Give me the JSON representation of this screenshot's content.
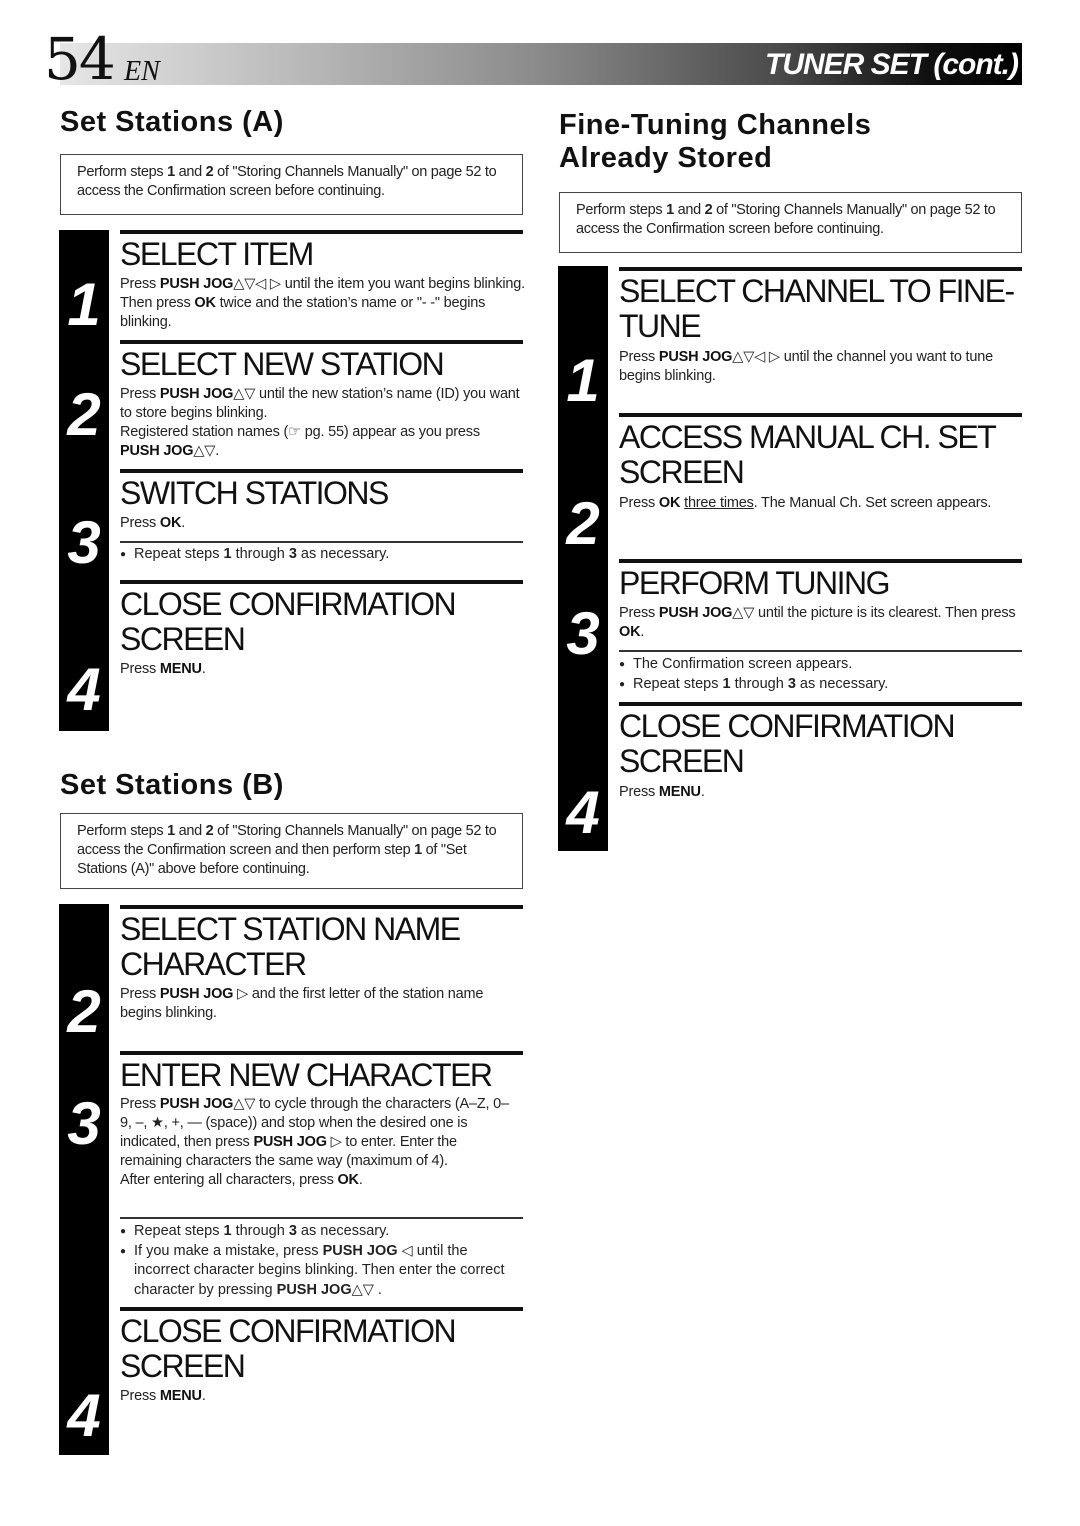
{
  "header": {
    "page_number": "54",
    "language": "EN",
    "section_title": "TUNER SET (cont.)"
  },
  "set_stations_a": {
    "title": "Set Stations (A)",
    "note": [
      "Perform steps ",
      "1",
      " and ",
      "2",
      " of \"Storing Channels Manually\" on page 52 to access the Confirmation screen before continuing."
    ],
    "steps": [
      {
        "number": "1",
        "title": "SELECT ITEM",
        "body": [
          "Press ",
          "PUSH JOG",
          "△▽◁ ▷ until the item you want begins blinking. Then press ",
          "OK",
          " twice and the station’s name or \"- -\" begins blinking."
        ]
      },
      {
        "number": "2",
        "title": "SELECT NEW STATION",
        "body": [
          "Press ",
          "PUSH JOG",
          "△▽ until the new station’s name (ID) you want to store begins blinking."
        ],
        "body2": [
          "Registered station names (",
          "☞",
          " pg. 55) appear as you press ",
          "PUSH JOG",
          "△▽."
        ]
      },
      {
        "number": "3",
        "title": "SWITCH STATIONS",
        "body": [
          "Press ",
          "OK",
          "."
        ],
        "bullets": [
          [
            "Repeat steps ",
            "1",
            " through ",
            "3",
            " as necessary."
          ]
        ]
      },
      {
        "number": "4",
        "title": "CLOSE CONFIRMATION SCREEN",
        "body": [
          "Press ",
          "MENU",
          "."
        ]
      }
    ]
  },
  "set_stations_b": {
    "title": "Set Stations (B)",
    "note": [
      "Perform steps ",
      "1",
      " and ",
      "2",
      " of \"Storing Channels Manually\" on page 52 to access the Confirmation screen and then perform step ",
      "1",
      " of \"Set Stations (A)\" above before continuing."
    ],
    "steps": [
      {
        "number": "2",
        "title": "SELECT STATION NAME CHARACTER",
        "body": [
          "Press ",
          "PUSH JOG",
          " ▷ and the first letter of the station name begins blinking."
        ]
      },
      {
        "number": "3",
        "title": "ENTER NEW CHARACTER",
        "body": [
          "Press ",
          "PUSH JOG",
          "△▽ to cycle through the characters (A–Z, 0–9, –, ★, +, — (space)) and stop when the desired one is indicated, then press ",
          "PUSH JOG",
          " ▷ to enter. Enter the remaining characters the same way (maximum of 4)."
        ],
        "body2": [
          "After entering all characters, press ",
          "OK",
          "."
        ],
        "bullets": [
          [
            "Repeat steps ",
            "1",
            " through ",
            "3",
            " as necessary."
          ],
          [
            "If you make a mistake, press ",
            "PUSH JOG",
            " ◁ until the incorrect character begins blinking. Then enter the correct character by pressing ",
            "PUSH JOG",
            "△▽ ."
          ]
        ]
      },
      {
        "number": "4",
        "title": "CLOSE CONFIRMATION SCREEN",
        "body": [
          "Press ",
          "MENU",
          "."
        ]
      }
    ]
  },
  "fine_tuning": {
    "title": "Fine-Tuning Channels Already Stored",
    "note": [
      "Perform steps ",
      "1",
      " and ",
      "2",
      " of \"Storing Channels Manually\" on page 52 to access the Confirmation screen before continuing."
    ],
    "steps": [
      {
        "number": "1",
        "title": "SELECT CHANNEL TO FINE-TUNE",
        "body": [
          "Press ",
          "PUSH JOG",
          "△▽◁ ▷ until the channel you want to tune begins blinking."
        ]
      },
      {
        "number": "2",
        "title": "ACCESS MANUAL CH. SET SCREEN",
        "body": [
          "Press ",
          "OK",
          " ",
          "three times",
          ". The Manual Ch. Set screen appears."
        ]
      },
      {
        "number": "3",
        "title": "PERFORM TUNING",
        "body": [
          "Press ",
          "PUSH JOG",
          "△▽ until the picture is its clearest. Then press ",
          "OK",
          "."
        ],
        "bullets": [
          [
            "The Confirmation screen appears."
          ],
          [
            "Repeat steps ",
            "1",
            " through ",
            "3",
            " as necessary."
          ]
        ]
      },
      {
        "number": "4",
        "title": "CLOSE CONFIRMATION SCREEN",
        "body": [
          "Press ",
          "MENU",
          "."
        ]
      }
    ]
  }
}
